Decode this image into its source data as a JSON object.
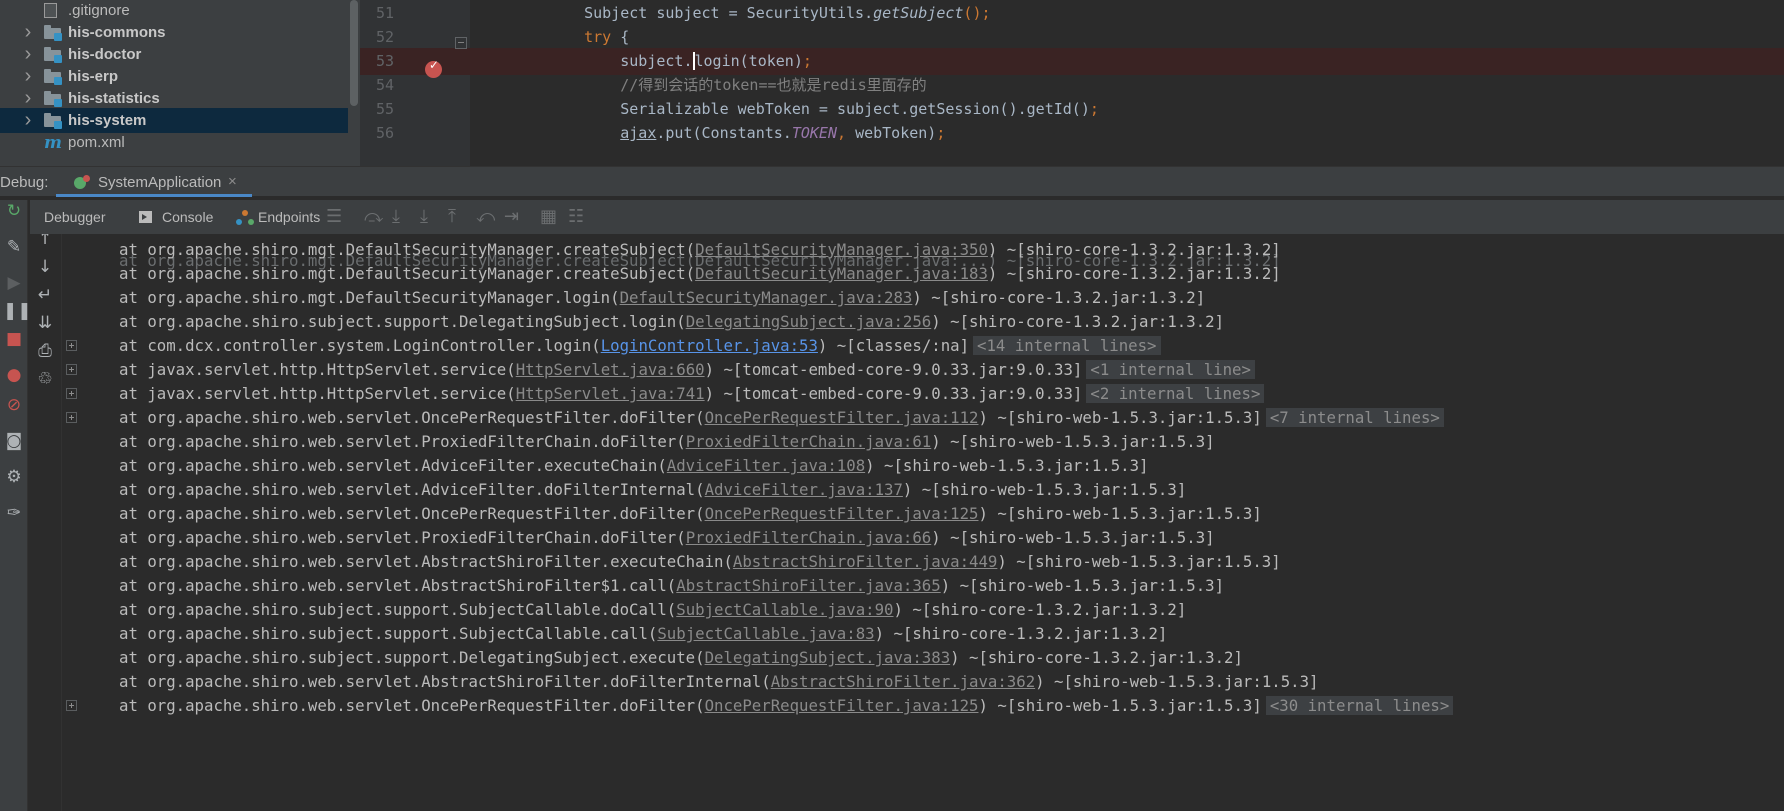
{
  "project_tree": {
    "items": [
      {
        "type": "file",
        "label": ".gitignore",
        "expandable": false,
        "bold": false,
        "selected": false
      },
      {
        "type": "folder",
        "label": "his-commons",
        "expandable": true,
        "bold": true,
        "selected": false
      },
      {
        "type": "folder",
        "label": "his-doctor",
        "expandable": true,
        "bold": true,
        "selected": false
      },
      {
        "type": "folder",
        "label": "his-erp",
        "expandable": true,
        "bold": true,
        "selected": false
      },
      {
        "type": "folder",
        "label": "his-statistics",
        "expandable": true,
        "bold": true,
        "selected": false
      },
      {
        "type": "folder",
        "label": "his-system",
        "expandable": true,
        "bold": true,
        "selected": true
      },
      {
        "type": "maven",
        "label": "pom.xml",
        "expandable": false,
        "bold": false,
        "selected": false
      }
    ]
  },
  "editor": {
    "lines": [
      {
        "number": "51",
        "indent": "    ",
        "breakpoint": false,
        "tokens": [
          {
            "t": "Subject subject = SecurityUtils."
          },
          {
            "t": "getSubject",
            "c": "tok-italic"
          },
          {
            "t": "();",
            "c": "tok-kw"
          }
        ]
      },
      {
        "number": "52",
        "indent": "    ",
        "breakpoint": false,
        "tokens": [
          {
            "t": "try ",
            "c": "tok-kw"
          },
          {
            "t": "{"
          }
        ]
      },
      {
        "number": "53",
        "indent": "        ",
        "breakpoint": true,
        "tokens": [
          {
            "t": "subject."
          },
          {
            "t": "login",
            "c": "caret"
          },
          {
            "t": "(token)"
          },
          {
            "t": ";",
            "c": "tok-kw"
          }
        ]
      },
      {
        "number": "54",
        "indent": "        ",
        "breakpoint": false,
        "tokens": [
          {
            "t": "//得到会话的token==也就是redis里面存的",
            "c": "tok-comment"
          }
        ]
      },
      {
        "number": "55",
        "indent": "        ",
        "breakpoint": false,
        "tokens": [
          {
            "t": "Serializable webToken = subject.getSession().getId()"
          },
          {
            "t": ";",
            "c": "tok-kw"
          }
        ]
      },
      {
        "number": "56",
        "indent": "        ",
        "breakpoint": false,
        "tokens": [
          {
            "t": "ajax",
            "c": "tok-underline"
          },
          {
            "t": ".put(Constants."
          },
          {
            "t": "TOKEN",
            "c": "tok-const"
          },
          {
            "t": ", ",
            "c": "tok-kw"
          },
          {
            "t": "webToken)"
          },
          {
            "t": ";",
            "c": "tok-kw"
          }
        ]
      }
    ]
  },
  "debug": {
    "title": "Debug:",
    "run_tab": {
      "label": "SystemApplication",
      "close": "×"
    },
    "tabs": {
      "debugger": "Debugger",
      "console": "Console",
      "endpoints": "Endpoints"
    }
  },
  "console": {
    "partial_line": "at org.apache.shiro.mgt.DefaultSecurityManager.createSubject(DefaultSecurityManager.java:...) ~[shiro-core-1.3.2.jar:1.3.2]",
    "lines": [
      {
        "prefix": "at org.apache.shiro.mgt.DefaultSecurityManager.createSubject(",
        "link": "DefaultSecurityManager.java:350",
        "suffix": ") ~[shiro-core-1.3.2.jar:1.3.2]",
        "internal": "",
        "expand": false,
        "active": false
      },
      {
        "prefix": "at org.apache.shiro.mgt.DefaultSecurityManager.createSubject(",
        "link": "DefaultSecurityManager.java:183",
        "suffix": ") ~[shiro-core-1.3.2.jar:1.3.2]",
        "internal": "",
        "expand": false,
        "active": false
      },
      {
        "prefix": "at org.apache.shiro.mgt.DefaultSecurityManager.login(",
        "link": "DefaultSecurityManager.java:283",
        "suffix": ") ~[shiro-core-1.3.2.jar:1.3.2]",
        "internal": "",
        "expand": false,
        "active": false
      },
      {
        "prefix": "at org.apache.shiro.subject.support.DelegatingSubject.login(",
        "link": "DelegatingSubject.java:256",
        "suffix": ") ~[shiro-core-1.3.2.jar:1.3.2]",
        "internal": "",
        "expand": false,
        "active": false
      },
      {
        "prefix": "at com.dcx.controller.system.LoginController.login(",
        "link": "LoginController.java:53",
        "suffix": ") ~[classes/:na]",
        "internal": "<14 internal lines>",
        "expand": true,
        "active": true
      },
      {
        "prefix": "at javax.servlet.http.HttpServlet.service(",
        "link": "HttpServlet.java:660",
        "suffix": ") ~[tomcat-embed-core-9.0.33.jar:9.0.33]",
        "internal": "<1 internal line>",
        "expand": true,
        "active": false
      },
      {
        "prefix": "at javax.servlet.http.HttpServlet.service(",
        "link": "HttpServlet.java:741",
        "suffix": ") ~[tomcat-embed-core-9.0.33.jar:9.0.33]",
        "internal": "<2 internal lines>",
        "expand": true,
        "active": false
      },
      {
        "prefix": "at org.apache.shiro.web.servlet.OncePerRequestFilter.doFilter(",
        "link": "OncePerRequestFilter.java:112",
        "suffix": ") ~[shiro-web-1.5.3.jar:1.5.3]",
        "internal": "<7 internal lines>",
        "expand": true,
        "active": false
      },
      {
        "prefix": "at org.apache.shiro.web.servlet.ProxiedFilterChain.doFilter(",
        "link": "ProxiedFilterChain.java:61",
        "suffix": ") ~[shiro-web-1.5.3.jar:1.5.3]",
        "internal": "",
        "expand": false,
        "active": false
      },
      {
        "prefix": "at org.apache.shiro.web.servlet.AdviceFilter.executeChain(",
        "link": "AdviceFilter.java:108",
        "suffix": ") ~[shiro-web-1.5.3.jar:1.5.3]",
        "internal": "",
        "expand": false,
        "active": false
      },
      {
        "prefix": "at org.apache.shiro.web.servlet.AdviceFilter.doFilterInternal(",
        "link": "AdviceFilter.java:137",
        "suffix": ") ~[shiro-web-1.5.3.jar:1.5.3]",
        "internal": "",
        "expand": false,
        "active": false
      },
      {
        "prefix": "at org.apache.shiro.web.servlet.OncePerRequestFilter.doFilter(",
        "link": "OncePerRequestFilter.java:125",
        "suffix": ") ~[shiro-web-1.5.3.jar:1.5.3]",
        "internal": "",
        "expand": false,
        "active": false
      },
      {
        "prefix": "at org.apache.shiro.web.servlet.ProxiedFilterChain.doFilter(",
        "link": "ProxiedFilterChain.java:66",
        "suffix": ") ~[shiro-web-1.5.3.jar:1.5.3]",
        "internal": "",
        "expand": false,
        "active": false
      },
      {
        "prefix": "at org.apache.shiro.web.servlet.AbstractShiroFilter.executeChain(",
        "link": "AbstractShiroFilter.java:449",
        "suffix": ") ~[shiro-web-1.5.3.jar:1.5.3]",
        "internal": "",
        "expand": false,
        "active": false
      },
      {
        "prefix": "at org.apache.shiro.web.servlet.AbstractShiroFilter$1.call(",
        "link": "AbstractShiroFilter.java:365",
        "suffix": ") ~[shiro-web-1.5.3.jar:1.5.3]",
        "internal": "",
        "expand": false,
        "active": false
      },
      {
        "prefix": "at org.apache.shiro.subject.support.SubjectCallable.doCall(",
        "link": "SubjectCallable.java:90",
        "suffix": ") ~[shiro-core-1.3.2.jar:1.3.2]",
        "internal": "",
        "expand": false,
        "active": false
      },
      {
        "prefix": "at org.apache.shiro.subject.support.SubjectCallable.call(",
        "link": "SubjectCallable.java:83",
        "suffix": ") ~[shiro-core-1.3.2.jar:1.3.2]",
        "internal": "",
        "expand": false,
        "active": false
      },
      {
        "prefix": "at org.apache.shiro.subject.support.DelegatingSubject.execute(",
        "link": "DelegatingSubject.java:383",
        "suffix": ") ~[shiro-core-1.3.2.jar:1.3.2]",
        "internal": "",
        "expand": false,
        "active": false
      },
      {
        "prefix": "at org.apache.shiro.web.servlet.AbstractShiroFilter.doFilterInternal(",
        "link": "AbstractShiroFilter.java:362",
        "suffix": ") ~[shiro-web-1.5.3.jar:1.5.3]",
        "internal": "",
        "expand": false,
        "active": false
      },
      {
        "prefix": "at org.apache.shiro.web.servlet.OncePerRequestFilter.doFilter(",
        "link": "OncePerRequestFilter.java:125",
        "suffix": ") ~[shiro-web-1.5.3.jar:1.5.3]",
        "internal": "<30 internal lines>",
        "expand": true,
        "active": false
      }
    ]
  },
  "icons": {
    "left_toolbar": [
      "rerun-icon",
      "settings-wrench-icon",
      "resume-icon",
      "pause-icon",
      "stop-icon",
      "view-breakpoints-icon",
      "mute-breakpoints-icon",
      "camera-icon",
      "gear-icon",
      "pin-icon"
    ],
    "console_nav": [
      "up-arrow-icon",
      "down-arrow-icon",
      "soft-wrap-icon",
      "scroll-to-end-icon",
      "print-icon",
      "trash-icon"
    ]
  },
  "colors": {
    "selection": "#0d293e",
    "link_active": "#5894e8",
    "breakpoint": "#c75450",
    "keyword": "#cc7832"
  }
}
